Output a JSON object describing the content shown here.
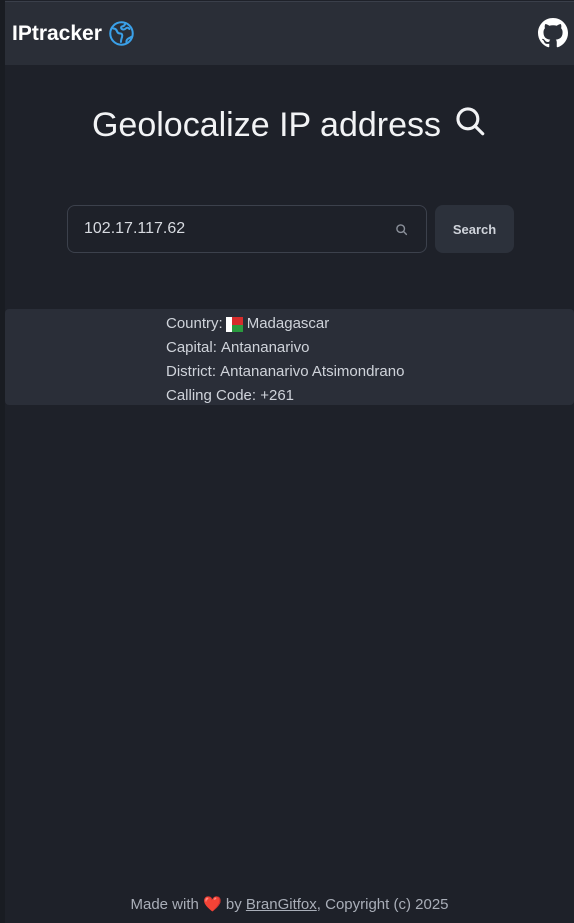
{
  "navbar": {
    "brand": "IPtracker",
    "brand_icon": "globe-icon",
    "github_icon": "github-icon"
  },
  "main": {
    "title": "Geolocalize IP address",
    "title_icon": "search-icon"
  },
  "search": {
    "value": "102.17.117.62",
    "button_label": "Search"
  },
  "result": {
    "country_label": "Country:",
    "country_value": "Madagascar",
    "capital_label": "Capital:",
    "capital_value": "Antananarivo",
    "district_label": "District:",
    "district_value": "Antananarivo Atsimondrano",
    "calling_label": "Calling Code:",
    "calling_value": "+261"
  },
  "footer": {
    "made_with": "Made with",
    "heart": "❤️",
    "by": "by",
    "author": "BranGitfox",
    "copyright": ", Copyright (c) 2025"
  },
  "colors": {
    "background": "#1e2129",
    "navbar": "#2a2e37",
    "result_panel": "#2a2e38",
    "accent_globe": "#3aa0e8"
  }
}
